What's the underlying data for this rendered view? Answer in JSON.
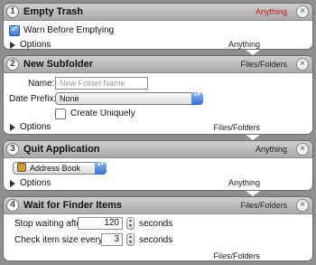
{
  "actions": [
    {
      "number": "1",
      "title": "Empty Trash",
      "type": "Anything",
      "type_color": "#c41a1a",
      "checkbox_label": "Warn Before Emptying",
      "checkbox_checked": true,
      "options_label": "Options",
      "footer_type": "Anything"
    },
    {
      "number": "2",
      "title": "New Subfolder",
      "type": "Files/Folders",
      "name_label": "Name:",
      "name_placeholder": "New Folder Name",
      "date_prefix_label": "Date Prefix:",
      "date_prefix_value": "None",
      "create_uniquely_label": "Create Uniquely",
      "create_uniquely_checked": false,
      "options_label": "Options",
      "footer_type": "Files/Folders"
    },
    {
      "number": "3",
      "title": "Quit Application",
      "type": "Anything",
      "app_value": "Address Book",
      "options_label": "Options",
      "footer_type": "Anything"
    },
    {
      "number": "4",
      "title": "Wait for Finder Items",
      "type": "Files/Folders",
      "stop_label": "Stop waiting after",
      "stop_value": "120",
      "stop_unit": "seconds",
      "check_label": "Check item size every",
      "check_value": "3",
      "check_unit": "seconds",
      "footer_type": "Files/Folders"
    }
  ],
  "icons": {
    "close": "×",
    "disclosure": "disclosure-triangle-icon",
    "popup_arrows": "▴▾"
  }
}
